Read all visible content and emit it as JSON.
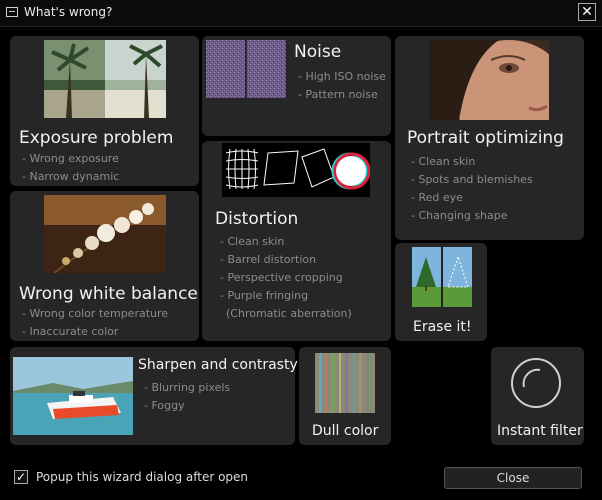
{
  "window": {
    "title": "What's wrong?"
  },
  "cards": {
    "exposure": {
      "title": "Exposure problem",
      "items": [
        "- Wrong exposure",
        "- Narrow dynamic"
      ]
    },
    "noise": {
      "title": "Noise",
      "items": [
        "- High ISO noise",
        "- Pattern noise"
      ]
    },
    "portrait": {
      "title": "Portrait optimizing",
      "items": [
        "- Clean skin",
        "- Spots and blemishes",
        "- Red eye",
        "- Changing shape"
      ]
    },
    "white_balance": {
      "title": "Wrong white balance",
      "items": [
        "- Wrong color temperature",
        "- Inaccurate color"
      ]
    },
    "distortion": {
      "title": "Distortion",
      "items": [
        "- Clean skin",
        "- Barrel distortion",
        "- Perspective cropping",
        "- Purple fringing",
        "(Chromatic aberration)"
      ]
    },
    "erase": {
      "title": "Erase it!"
    },
    "sharpen": {
      "title": "Sharpen and contrasty",
      "items": [
        "- Blurring pixels",
        "- Foggy"
      ]
    },
    "dull": {
      "title": "Dull color"
    },
    "instant": {
      "title": "Instant filter"
    }
  },
  "footer": {
    "checkbox_label": "Popup this wizard dialog after open",
    "checkbox_checked": true,
    "close_label": "Close"
  }
}
